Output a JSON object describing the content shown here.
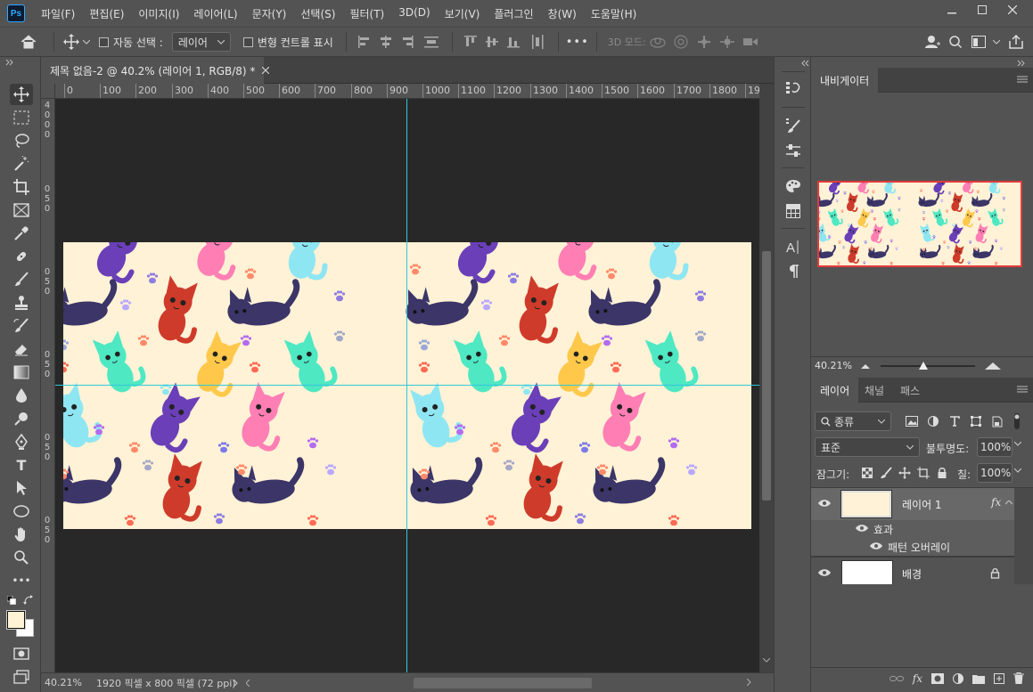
{
  "menubar": {
    "logo": "Ps",
    "items": [
      "파일(F)",
      "편집(E)",
      "이미지(I)",
      "레이어(L)",
      "문자(Y)",
      "선택(S)",
      "필터(T)",
      "3D(D)",
      "보기(V)",
      "플러그인",
      "창(W)",
      "도움말(H)"
    ]
  },
  "options": {
    "auto_select_label": "자동 선택 :",
    "auto_select_value": "레이어",
    "transform_label": "변형 컨트롤 표시",
    "mode_3d_label": "3D 모드:",
    "more": "•••"
  },
  "document": {
    "tab_title": "제목 없음-2 @ 40.2% (레이어 1, RGB/8) *",
    "ruler_top": [
      "0",
      "100",
      "200",
      "300",
      "400",
      "500",
      "600",
      "700",
      "800",
      "900",
      "1000",
      "1100",
      "1200",
      "1300",
      "1400",
      "1500",
      "1600",
      "1700",
      "1800",
      "190"
    ],
    "ruler_left": [
      "4",
      "0",
      "0",
      "0",
      "0",
      "5",
      "0",
      "0",
      "5",
      "0",
      "0",
      "5",
      "0",
      "0",
      "5",
      "0",
      "0",
      "5",
      "0",
      "0"
    ],
    "zoom": "40.21%",
    "doc_info": "1920 픽셀 x 800 픽셀 (72 ppi)",
    "canvas_color": "#fff2d6",
    "guide_color": "#33c8d8"
  },
  "navigator": {
    "tab": "내비게이터",
    "zoom": "40.21%",
    "zoom_level": 0.45
  },
  "layers": {
    "tabs": [
      "레이어",
      "채널",
      "패스"
    ],
    "filter_kind": "종류",
    "blend_mode": "표준",
    "opacity_label": "불투명도:",
    "opacity_value": "100%",
    "lock_label": "잠그기:",
    "fill_label": "칠:",
    "fill_value": "100%",
    "items": [
      {
        "name": "레이어 1",
        "fx": "fx"
      },
      {
        "name": "효과"
      },
      {
        "name": "패턴 오버레이"
      },
      {
        "name": "배경"
      }
    ]
  }
}
